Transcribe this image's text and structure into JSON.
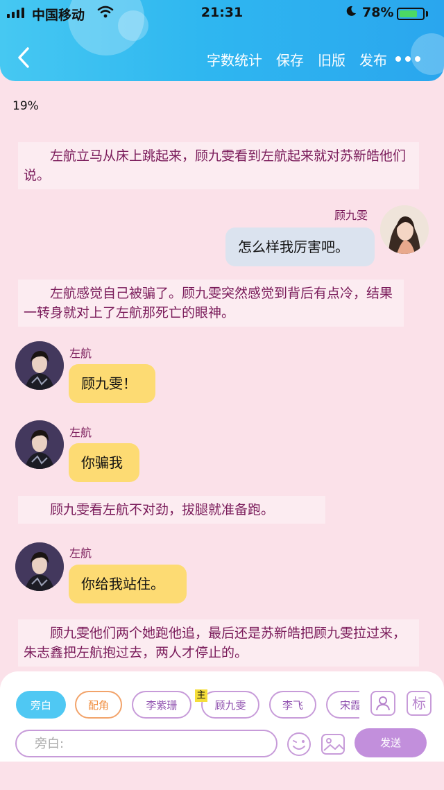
{
  "status_bar": {
    "carrier": "中国移动",
    "time": "21:31",
    "battery_pct": "78%",
    "battery_level": 0.78
  },
  "toolbar": {
    "word_count": "字数统计",
    "save": "保存",
    "old_version": "旧版",
    "publish": "发布"
  },
  "progress": "19%",
  "chat": {
    "n1": "　　左航立马从床上跳起来，顾九雯看到左航起来就对苏新皓他们说。",
    "r1_name": "顾九雯",
    "r1_text": "怎么样我厉害吧。",
    "n2": "　　左航感觉自己被骗了。顾九雯突然感觉到背后有点冷，结果一转身就对上了左航那死亡的眼神。",
    "l1_name": "左航",
    "l1_text": "顾九雯！",
    "l2_name": "左航",
    "l2_text": "你骗我",
    "n3": "　　顾九雯看左航不对劲，拔腿就准备跑。",
    "l3_name": "左航",
    "l3_text": "你给我站住。",
    "n4": "　　顾九雯他们两个她跑他追，最后还是苏新皓把顾九雯拉过来，朱志鑫把左航抱过去，两人才停止的。"
  },
  "composer": {
    "roles": [
      "旁白",
      "配角",
      "李紫珊",
      "顾九雯",
      "李飞",
      "宋霞"
    ],
    "main_badge": "主",
    "tag_button": "标",
    "placeholder": "旁白:",
    "send": "发送"
  },
  "colors": {
    "header_blue": "#2fb7f0",
    "background_pink": "#fbe1e9",
    "narration_text": "#7a1b5a",
    "left_bubble": "#fddb73",
    "right_bubble": "#dbe3ef",
    "send_button": "#c28fdc"
  }
}
